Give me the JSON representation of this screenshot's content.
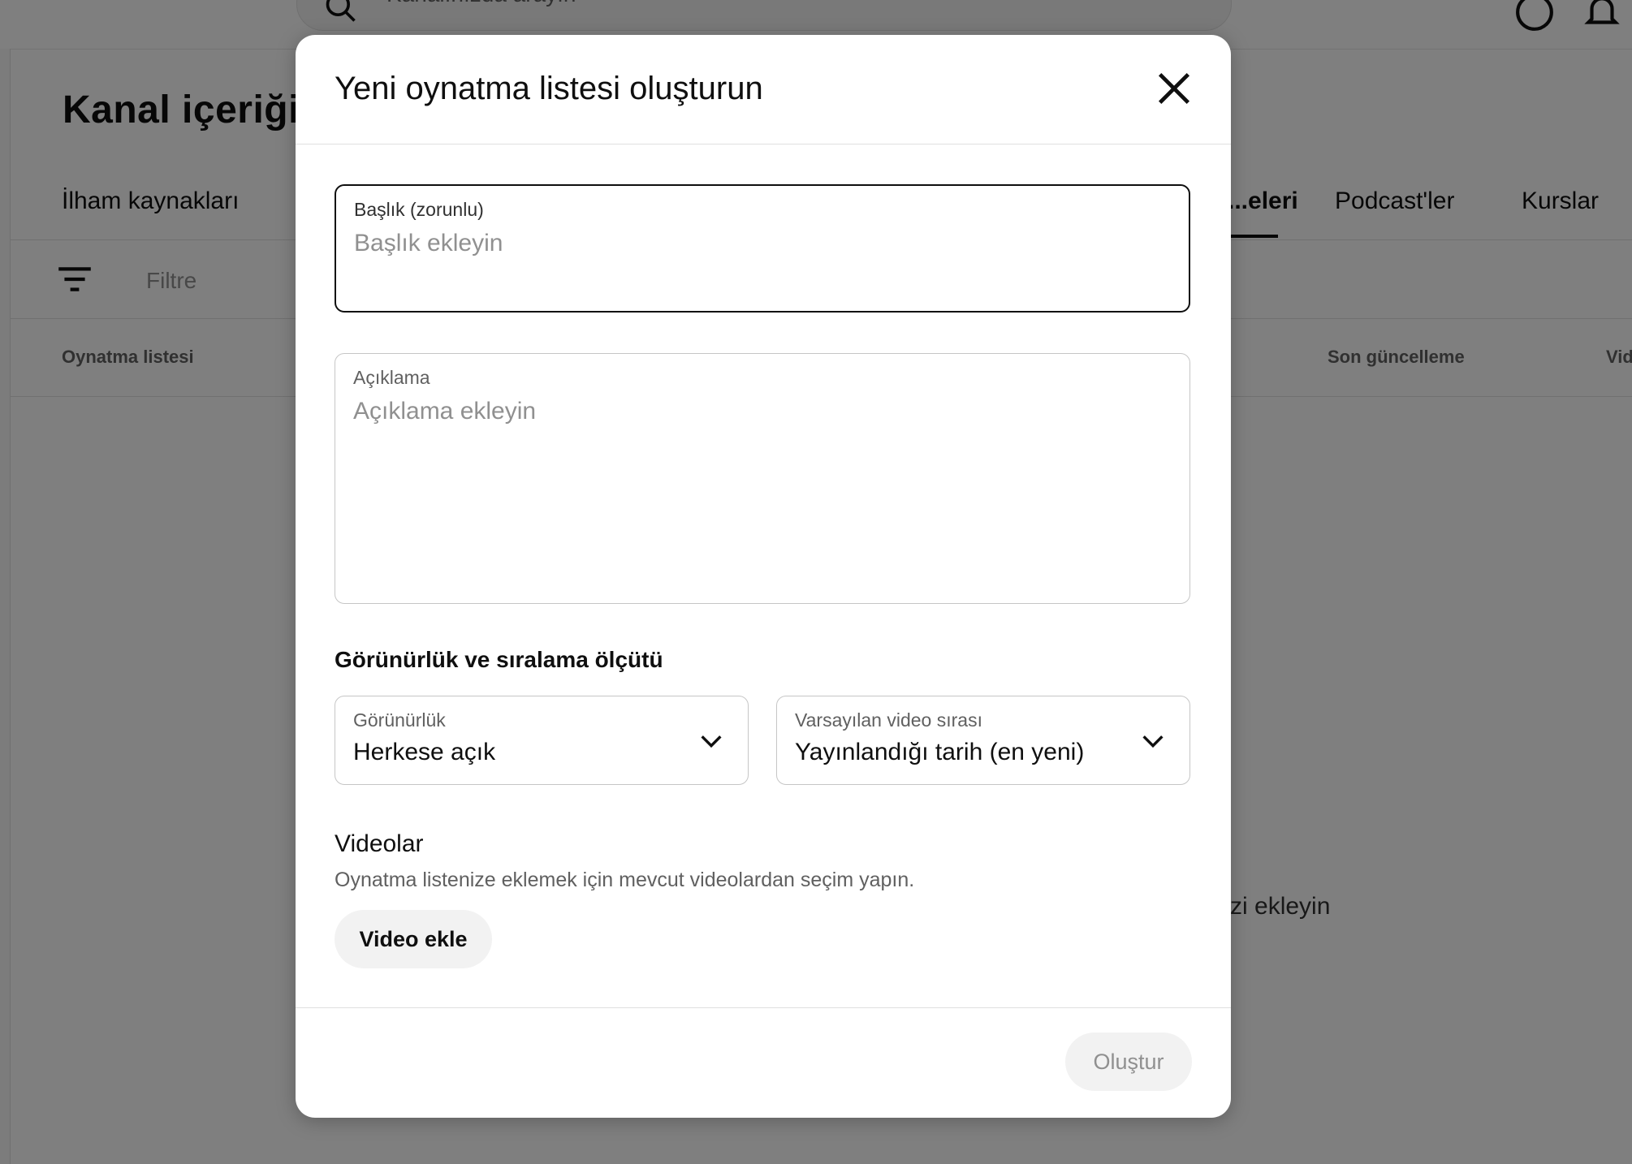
{
  "background": {
    "search": {
      "placeholder": "Kanalınızda arayın"
    },
    "page_title": "Kanal içeriği",
    "tabs": [
      {
        "label": "İlham kaynakları"
      },
      {
        "label": "...eleri",
        "active": true
      },
      {
        "label": "Podcast'ler"
      },
      {
        "label": "Kurslar"
      }
    ],
    "filter_placeholder": "Filtre",
    "columns": [
      "Oynatma listesi",
      "Son güncelleme",
      "Vid..."
    ],
    "empty_state_fragment": "...zi ekleyin",
    "icons": [
      "search-icon",
      "help-icon",
      "notifications-icon",
      "filter-icon"
    ]
  },
  "dialog": {
    "title": "Yeni oynatma listesi oluşturun",
    "title_field": {
      "label": "Başlık (zorunlu)",
      "placeholder": "Başlık ekleyin",
      "value": ""
    },
    "description_field": {
      "label": "Açıklama",
      "placeholder": "Açıklama ekleyin",
      "value": ""
    },
    "visibility_section_title": "Görünürlük ve sıralama ölçütü",
    "visibility_select": {
      "label": "Görünürlük",
      "value": "Herkese açık"
    },
    "order_select": {
      "label": "Varsayılan video sırası",
      "value": "Yayınlandığı tarih (en yeni)"
    },
    "videos_section": {
      "title": "Videolar",
      "subtitle": "Oynatma listenize eklemek için mevcut videolardan seçim yapın.",
      "add_button": "Video ekle"
    },
    "create_button": "Oluştur",
    "create_enabled": false
  },
  "colors": {
    "backdrop": "rgba(0,0,0,0.5)",
    "text_primary": "#0f0f0f",
    "text_secondary": "#606060",
    "placeholder": "#909090",
    "button_bg": "#f2f2f2"
  }
}
